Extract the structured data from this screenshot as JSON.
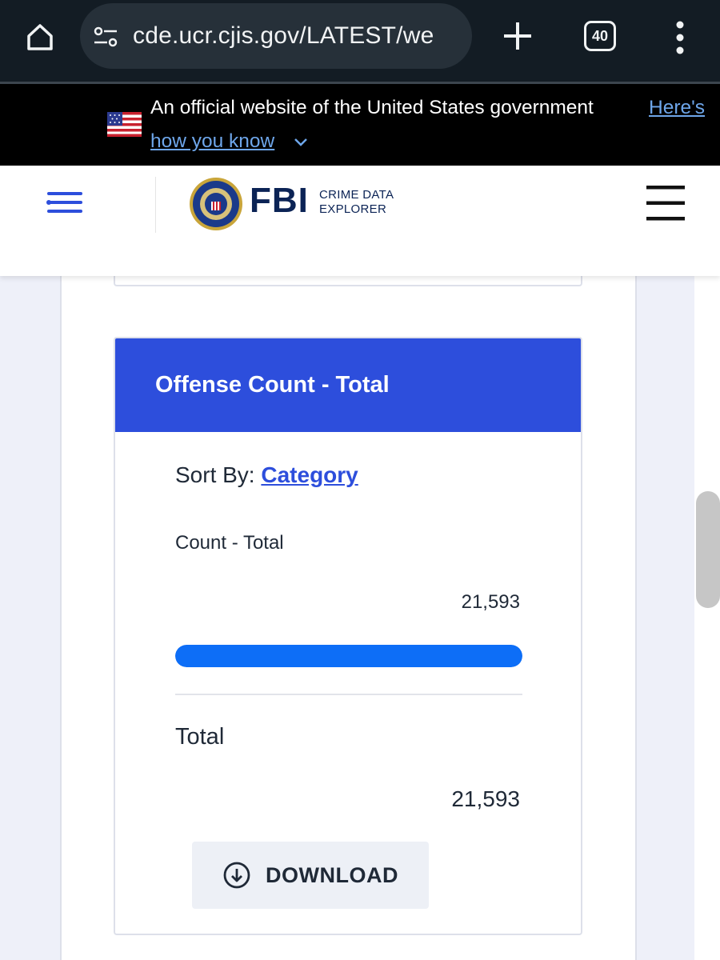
{
  "browser": {
    "url": "cde.ucr.cjis.gov/LATEST/we",
    "tab_count": "40"
  },
  "gov_banner": {
    "text": "An official website of the United States government",
    "link_part1": "Here's",
    "link_part2": "how you know"
  },
  "header": {
    "brand": "FBI",
    "product_line1": "CRIME DATA",
    "product_line2": "EXPLORER"
  },
  "offense_card": {
    "title": "Offense Count - Total",
    "sort_label": "Sort By:",
    "sort_value": "Category",
    "count_label": "Count - Total",
    "count_value": "21,593",
    "bar_fill_fraction": 1.0,
    "total_label": "Total",
    "total_value": "21,593",
    "download_label": "DOWNLOAD"
  },
  "colors": {
    "accent": "#2d4edc",
    "bar": "#0d6ef7",
    "link": "#6ea6ea",
    "brand_navy": "#0b2355"
  },
  "icons": {
    "home": "home-icon",
    "site_settings": "tune-icon",
    "new_tab": "plus-icon",
    "tabs": "tab-switcher-icon",
    "overflow": "more-vert-icon",
    "side_menu": "list-menu-icon",
    "menu": "hamburger-icon",
    "download": "download-circle-icon"
  }
}
